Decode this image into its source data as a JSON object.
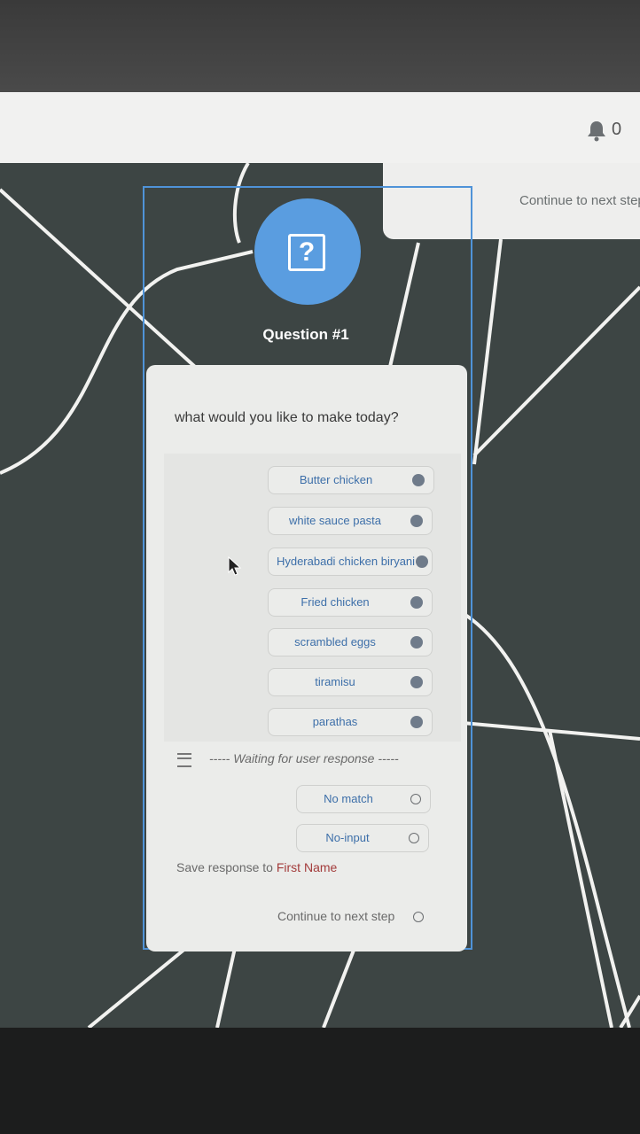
{
  "header": {
    "notification_count": "0",
    "icons": [
      "bell-icon"
    ]
  },
  "side_card": {
    "text": "Continue to next step"
  },
  "node": {
    "icon": "question-icon",
    "icon_glyph": "?",
    "title": "Question #1",
    "accent": "#5a9de0"
  },
  "question": {
    "prompt": "what would you like to make today?"
  },
  "options": [
    {
      "label": "Butter chicken"
    },
    {
      "label": "white sauce pasta"
    },
    {
      "label": "Hyderabadi chicken biryani"
    },
    {
      "label": "Fried chicken"
    },
    {
      "label": "scrambled eggs"
    },
    {
      "label": "tiramisu"
    },
    {
      "label": "parathas"
    }
  ],
  "waiting": {
    "text": "----- Waiting for user response -----"
  },
  "fallbacks": [
    {
      "label": "No match"
    },
    {
      "label": "No-input"
    }
  ],
  "save": {
    "prefix": "Save response to ",
    "variable": "First Name"
  },
  "continue": {
    "label": "Continue to next step"
  }
}
